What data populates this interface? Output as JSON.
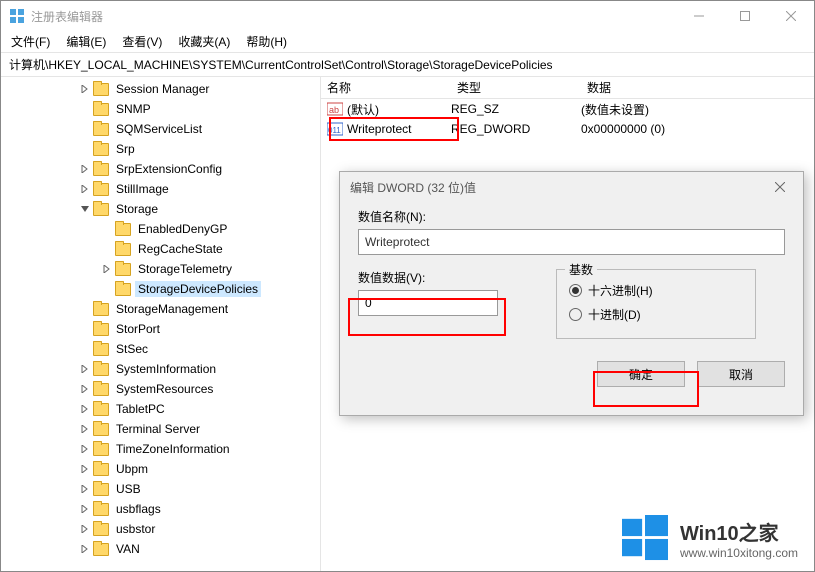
{
  "window": {
    "title": "注册表编辑器",
    "controls": {
      "min": "—",
      "max": "□",
      "close": "✕"
    }
  },
  "menubar": {
    "file": "文件(F)",
    "edit": "编辑(E)",
    "view": "查看(V)",
    "favorites": "收藏夹(A)",
    "help": "帮助(H)"
  },
  "address": "计算机\\HKEY_LOCAL_MACHINE\\SYSTEM\\CurrentControlSet\\Control\\Storage\\StorageDevicePolicies",
  "tree": {
    "items": [
      {
        "indent": 78,
        "chev": ">",
        "label": "Session Manager"
      },
      {
        "indent": 78,
        "chev": "",
        "label": "SNMP"
      },
      {
        "indent": 78,
        "chev": "",
        "label": "SQMServiceList"
      },
      {
        "indent": 78,
        "chev": "",
        "label": "Srp"
      },
      {
        "indent": 78,
        "chev": ">",
        "label": "SrpExtensionConfig"
      },
      {
        "indent": 78,
        "chev": ">",
        "label": "StillImage"
      },
      {
        "indent": 78,
        "chev": "v",
        "label": "Storage"
      },
      {
        "indent": 100,
        "chev": "",
        "label": "EnabledDenyGP"
      },
      {
        "indent": 100,
        "chev": "",
        "label": "RegCacheState"
      },
      {
        "indent": 100,
        "chev": ">",
        "label": "StorageTelemetry"
      },
      {
        "indent": 100,
        "chev": "",
        "label": "StorageDevicePolicies",
        "selected": true
      },
      {
        "indent": 78,
        "chev": "",
        "label": "StorageManagement"
      },
      {
        "indent": 78,
        "chev": "",
        "label": "StorPort"
      },
      {
        "indent": 78,
        "chev": "",
        "label": "StSec"
      },
      {
        "indent": 78,
        "chev": ">",
        "label": "SystemInformation"
      },
      {
        "indent": 78,
        "chev": ">",
        "label": "SystemResources"
      },
      {
        "indent": 78,
        "chev": ">",
        "label": "TabletPC"
      },
      {
        "indent": 78,
        "chev": ">",
        "label": "Terminal Server"
      },
      {
        "indent": 78,
        "chev": ">",
        "label": "TimeZoneInformation"
      },
      {
        "indent": 78,
        "chev": ">",
        "label": "Ubpm"
      },
      {
        "indent": 78,
        "chev": ">",
        "label": "USB"
      },
      {
        "indent": 78,
        "chev": ">",
        "label": "usbflags"
      },
      {
        "indent": 78,
        "chev": ">",
        "label": "usbstor"
      },
      {
        "indent": 78,
        "chev": ">",
        "label": "VAN"
      }
    ]
  },
  "list": {
    "headers": {
      "name": "名称",
      "type": "类型",
      "data": "数据"
    },
    "rows": [
      {
        "icon": "ab",
        "name": "(默认)",
        "type": "REG_SZ",
        "data": "(数值未设置)"
      },
      {
        "icon": "010",
        "name": "Writeprotect",
        "type": "REG_DWORD",
        "data": "0x00000000 (0)"
      }
    ]
  },
  "dialog": {
    "title": "编辑 DWORD (32 位)值",
    "name_label": "数值名称(N):",
    "name_value": "Writeprotect",
    "data_label": "数值数据(V):",
    "data_value": "0",
    "base_label": "基数",
    "radio_hex": "十六进制(H)",
    "radio_dec": "十进制(D)",
    "ok": "确定",
    "cancel": "取消"
  },
  "watermark": {
    "title": "Win10之家",
    "url": "www.win10xitong.com"
  }
}
